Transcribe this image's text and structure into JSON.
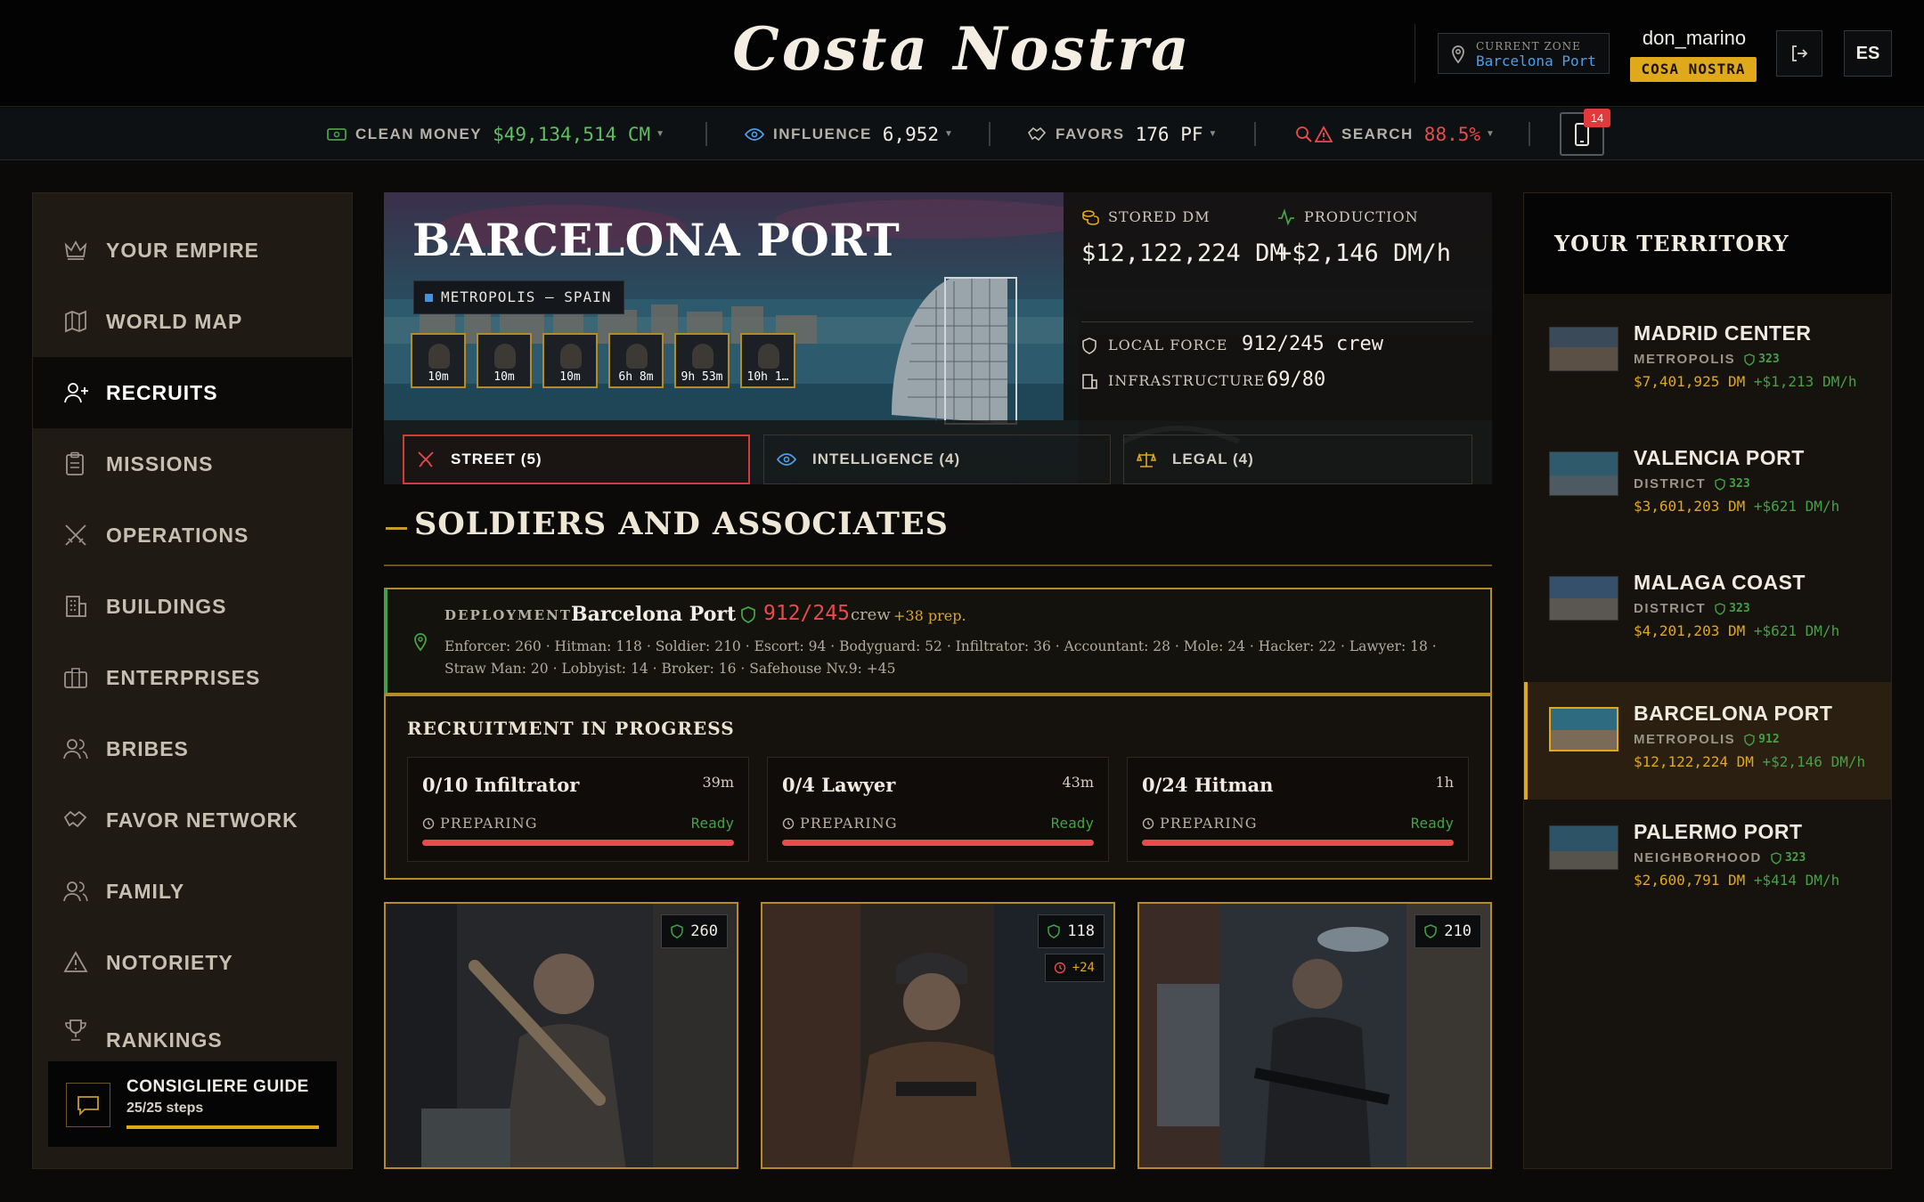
{
  "app": {
    "title": "Costa Nostra"
  },
  "header": {
    "zone_label": "CURRENT ZONE",
    "zone_value": "Barcelona Port",
    "username": "don_marino",
    "family_badge": "COSA NOSTRA",
    "lang": "ES",
    "notifications": "14"
  },
  "stats": {
    "clean_money": {
      "label": "CLEAN MONEY",
      "value": "$49,134,514 CM"
    },
    "influence": {
      "label": "INFLUENCE",
      "value": "6,952"
    },
    "favors": {
      "label": "FAVORS",
      "value": "176 PF"
    },
    "search": {
      "label": "SEARCH",
      "value": "88.5%"
    }
  },
  "sidebar": {
    "items": [
      {
        "label": "YOUR EMPIRE",
        "icon": "crown-icon"
      },
      {
        "label": "WORLD MAP",
        "icon": "map-icon"
      },
      {
        "label": "RECRUITS",
        "icon": "user-plus-icon"
      },
      {
        "label": "MISSIONS",
        "icon": "clipboard-icon"
      },
      {
        "label": "OPERATIONS",
        "icon": "crossed-swords-icon"
      },
      {
        "label": "BUILDINGS",
        "icon": "building-icon"
      },
      {
        "label": "ENTERPRISES",
        "icon": "briefcase-icon"
      },
      {
        "label": "BRIBES",
        "icon": "users-icon"
      },
      {
        "label": "FAVOR NETWORK",
        "icon": "handshake-icon"
      },
      {
        "label": "FAMILY",
        "icon": "family-icon"
      },
      {
        "label": "NOTORIETY",
        "icon": "warning-icon"
      },
      {
        "label": "RANKINGS",
        "icon": "trophy-icon"
      }
    ],
    "active": "RECRUITS",
    "guide": {
      "title": "CONSIGLIERE GUIDE",
      "steps": "25/25 steps"
    }
  },
  "hero": {
    "title": "BARCELONA PORT",
    "tag": "METROPOLIS — SPAIN",
    "timers": [
      "10m",
      "10m",
      "10m",
      "6h 8m",
      "9h 53m",
      "10h 1…"
    ],
    "stored_label": "STORED DM",
    "stored_value": "$12,122,224 DM",
    "production_label": "PRODUCTION",
    "production_value": "+$2,146 DM/h",
    "force_label": "LOCAL FORCE",
    "force_value": "912/245 crew",
    "infra_label": "INFRASTRUCTURE",
    "infra_value": "69/80",
    "tabs": [
      "STREET (5)",
      "INTELLIGENCE (4)",
      "LEGAL (4)"
    ]
  },
  "section": {
    "title": "SOLDIERS AND ASSOCIATES"
  },
  "deployment": {
    "label": "DEPLOYMENT",
    "zone": "Barcelona Port",
    "count": "912/245",
    "crew_word": "crew",
    "prep": "+38 prep.",
    "detail": "Enforcer: 260 · Hitman: 118 · Soldier: 210 · Escort: 94 · Bodyguard: 52 · Infiltrator: 36 · Accountant: 28 · Mole: 24 · Hacker: 22 · Lawyer: 18 · Straw Man: 20 · Lobbyist: 14 · Broker: 16 · Safehouse Nv.9: +45"
  },
  "recruitment": {
    "title": "RECRUITMENT IN PROGRESS",
    "items": [
      {
        "name": "0/10 Infiltrator",
        "time": "39m",
        "status": "PREPARING",
        "ready": "Ready",
        "progress": 1.0
      },
      {
        "name": "0/4 Lawyer",
        "time": "43m",
        "status": "PREPARING",
        "ready": "Ready",
        "progress": 1.0
      },
      {
        "name": "0/24 Hitman",
        "time": "1h",
        "status": "PREPARING",
        "ready": "Ready",
        "progress": 1.0
      }
    ]
  },
  "units": [
    {
      "count": "260"
    },
    {
      "count": "118",
      "extra": "+24"
    },
    {
      "count": "210"
    }
  ],
  "territory": {
    "title": "YOUR TERRITORY",
    "items": [
      {
        "name": "MADRID CENTER",
        "type": "METROPOLIS",
        "crew": "323",
        "money": "$7,401,925 DM",
        "prod": "+$1,213 DM/h"
      },
      {
        "name": "VALENCIA PORT",
        "type": "DISTRICT",
        "crew": "323",
        "money": "$3,601,203 DM",
        "prod": "+$621 DM/h"
      },
      {
        "name": "MALAGA COAST",
        "type": "DISTRICT",
        "crew": "323",
        "money": "$4,201,203 DM",
        "prod": "+$621 DM/h"
      },
      {
        "name": "BARCELONA PORT",
        "type": "METROPOLIS",
        "crew": "912",
        "money": "$12,122,224 DM",
        "prod": "+$2,146 DM/h"
      },
      {
        "name": "PALERMO PORT",
        "type": "NEIGHBORHOOD",
        "crew": "323",
        "money": "$2,600,791 DM",
        "prod": "+$414 DM/h"
      }
    ]
  },
  "colors": {
    "accent": "#e0a91c",
    "danger": "#e84b4b",
    "success": "#46a047",
    "info": "#4f9ee8"
  }
}
